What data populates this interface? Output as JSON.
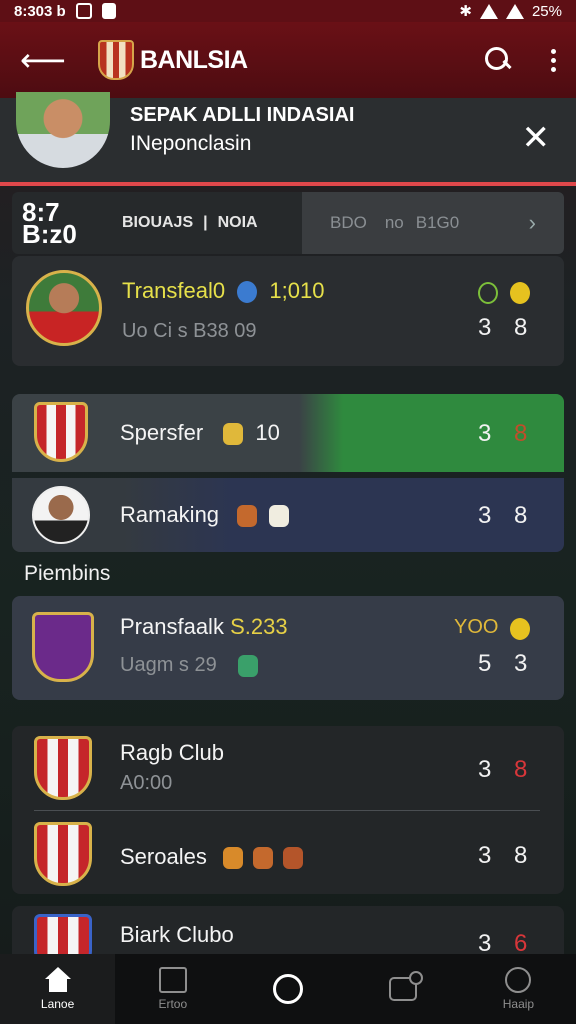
{
  "status_bar": {
    "time": "8:303 b",
    "battery": "25%"
  },
  "app_bar": {
    "title": "BANLSIA"
  },
  "notification": {
    "line1": "SEPAK ADLLI INDASIAI",
    "line2": "INeponclasin"
  },
  "score_strip": {
    "score_top": "8:7",
    "score_bottom": "B:z0",
    "tab_left": "BIOUAJS",
    "divider": "|",
    "tab_right": "NOIA",
    "right_left": "BDO",
    "right_mid": "no",
    "right_right": "B1G0"
  },
  "cards": [
    {
      "title": "Transfeal0",
      "title_extra": "1;010",
      "subtitle": "Uo Ci  s B38 09",
      "col1": "3",
      "col2": "8"
    },
    {
      "title": "Spersfer",
      "title_extra": "10",
      "col1": "3",
      "col2": "8"
    },
    {
      "title": "Ramaking",
      "col1": "3",
      "col2": "8"
    }
  ],
  "section_label": "Piembins",
  "cards2": [
    {
      "title": "Pransfaalk",
      "title_extra": "S.233",
      "subtitle": "Uagm s  29",
      "top_right": "YOO",
      "col1": "5",
      "col2": "3"
    },
    {
      "title": "Ragb Club",
      "subtitle": "A0:00",
      "col1": "3",
      "col2": "8"
    },
    {
      "title": "Seroales",
      "col1": "3",
      "col2": "8"
    },
    {
      "title": "Biark Clubo",
      "col1": "3",
      "col2": "6"
    }
  ],
  "bottom_nav": [
    {
      "label": "Lanoe"
    },
    {
      "label": "Ertoo"
    },
    {
      "label": ""
    },
    {
      "label": ""
    },
    {
      "label": "Haaip"
    }
  ],
  "colors": {
    "app_bar": "#5e0f15",
    "accent_red": "#e0484b",
    "highlight_green": "#2f8a3e",
    "highlight_navy": "#2c3552",
    "highlight_slate": "#363c48",
    "yellow_text": "#e6e04a",
    "gold_text": "#e0b83a"
  }
}
